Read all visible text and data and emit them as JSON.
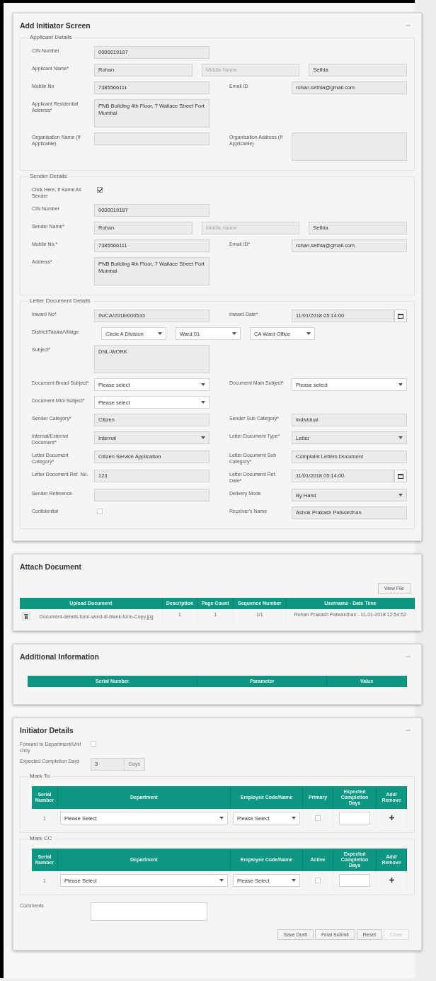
{
  "screen": {
    "title": "Add Initiator Screen",
    "collapsible": true,
    "fieldsets": [
      {
        "legend": "Applicant Details",
        "rows": [
          {
            "kind": "pair",
            "label": "CIN Number",
            "inputs": [
              {
                "kind": "text",
                "readonly": true,
                "value": "0000019187"
              }
            ]
          },
          {
            "kind": "multi",
            "label": "Applicant Name*",
            "inputs": [
              {
                "kind": "text",
                "readonly": true,
                "value": "Rohan"
              },
              {
                "kind": "text",
                "readonly": true,
                "placeholder": "Middle Name"
              },
              {
                "kind": "text",
                "readonly": true,
                "value": "Sethia"
              }
            ]
          },
          {
            "kind": "pair",
            "label": "Mobile No",
            "inputs": [
              {
                "kind": "text",
                "readonly": true,
                "value": "7385566111"
              }
            ],
            "label_2": "Email ID",
            "inputs_2": [
              {
                "kind": "text",
                "readonly": true,
                "value": "rohan.sethia@gmail.com"
              }
            ]
          },
          {
            "kind": "pair",
            "label": "Applicant Residential Address*",
            "inputs": [
              {
                "kind": "textarea",
                "readonly": true,
                "value": "PNB Building 4th Floor, 7 Wallace Street Fort Mumbai"
              }
            ]
          },
          {
            "kind": "pair",
            "label": "Organisation Name (If Applicable)",
            "inputs": [
              {
                "kind": "text",
                "readonly": true
              }
            ],
            "label_2": "Organisation Address (If Applicable)",
            "inputs_2": [
              {
                "kind": "textarea",
                "readonly": true
              }
            ]
          }
        ]
      },
      {
        "legend": "Sender Details",
        "rows": [
          {
            "kind": "pair",
            "label": "Click Here, If Same As Sender",
            "inputs": [
              {
                "kind": "checkbox",
                "checked": true
              }
            ]
          },
          {
            "kind": "pair",
            "label": "CIN Number",
            "inputs": [
              {
                "kind": "text",
                "readonly": true,
                "value": "0000019187"
              }
            ]
          },
          {
            "kind": "multi",
            "label": "Sender Name*",
            "inputs": [
              {
                "kind": "text",
                "readonly": true,
                "value": "Rohan"
              },
              {
                "kind": "text",
                "readonly": true,
                "placeholder": "Middle Name"
              },
              {
                "kind": "text",
                "readonly": true,
                "value": "Sethia"
              }
            ]
          },
          {
            "kind": "pair",
            "label": "Mobile No.*",
            "inputs": [
              {
                "kind": "text",
                "readonly": true,
                "value": "7385566111"
              }
            ],
            "label_2": "Email ID*",
            "inputs_2": [
              {
                "kind": "text",
                "readonly": true,
                "value": "rohan.sethia@gmail.com"
              }
            ]
          },
          {
            "kind": "pair",
            "label": "Address*",
            "inputs": [
              {
                "kind": "textarea",
                "readonly": true,
                "value": "PNB Building 4th Floor, 7 Wallace Street Fort Mumbai"
              }
            ]
          }
        ]
      },
      {
        "legend": "Letter Document Details",
        "rows": [
          {
            "kind": "pair",
            "label": "Inward No*",
            "inputs": [
              {
                "kind": "text",
                "readonly": true,
                "value": "IN/CA/2018/000533"
              }
            ],
            "label_2": "Inward Date*",
            "inputs_2": [
              {
                "kind": "date",
                "readonly": true,
                "value": "11/01/2018 05:14:00"
              }
            ]
          },
          {
            "kind": "multi",
            "label": "District/Taluka/Village",
            "inputs": [
              {
                "kind": "select",
                "readonly": false,
                "value": "Circle A Division"
              },
              {
                "kind": "select",
                "readonly": false,
                "value": "Ward 01"
              },
              {
                "kind": "select",
                "readonly": false,
                "value": "CA Ward Office"
              }
            ]
          },
          {
            "kind": "pair",
            "label": "Subject*",
            "inputs": [
              {
                "kind": "textarea",
                "readonly": true,
                "value": "DNL-WORK"
              }
            ]
          },
          {
            "kind": "pair",
            "label": "Document Broad Subject*",
            "inputs": [
              {
                "kind": "select",
                "readonly": false,
                "value": "Please select"
              }
            ],
            "label_2": "Document Main Subject*",
            "inputs_2": [
              {
                "kind": "select",
                "readonly": false,
                "value": "Please select"
              }
            ]
          },
          {
            "kind": "pair",
            "label": "Document Mini Subject*",
            "inputs": [
              {
                "kind": "select",
                "readonly": false,
                "value": "Please select"
              }
            ]
          },
          {
            "kind": "pair",
            "label": "Sender Category*",
            "inputs": [
              {
                "kind": "text",
                "readonly": true,
                "value": "Citizen"
              }
            ],
            "label_2": "Sender Sub Category*",
            "inputs_2": [
              {
                "kind": "text",
                "readonly": true,
                "value": "Individual"
              }
            ]
          },
          {
            "kind": "pair",
            "label": "Internal/External Document*",
            "inputs": [
              {
                "kind": "select",
                "readonly": true,
                "value": "Internal"
              }
            ],
            "label_2": "Letter Document Type*",
            "inputs_2": [
              {
                "kind": "select",
                "readonly": true,
                "value": "Letter"
              }
            ]
          },
          {
            "kind": "pair",
            "label": "Letter Document Category*",
            "inputs": [
              {
                "kind": "text",
                "readonly": true,
                "value": "Citizen Service Application"
              }
            ],
            "label_2": "Letter Document Sub Category*",
            "inputs_2": [
              {
                "kind": "text",
                "readonly": true,
                "value": "Complaint Letters Document"
              }
            ]
          },
          {
            "kind": "pair",
            "label": "Letter Document Ref. No.",
            "inputs": [
              {
                "kind": "text",
                "readonly": true,
                "value": "123"
              }
            ],
            "label_2": "Letter Document Ref. Date*",
            "inputs_2": [
              {
                "kind": "date",
                "readonly": true,
                "value": "11/01/2018 05:14:00"
              }
            ]
          },
          {
            "kind": "pair",
            "label": "Sender Reference",
            "inputs": [
              {
                "kind": "text",
                "readonly": true
              }
            ],
            "label_2": "Delivery Mode",
            "inputs_2": [
              {
                "kind": "select",
                "readonly": true,
                "value": "By Hand"
              }
            ]
          },
          {
            "kind": "pair",
            "label": "Confidential",
            "inputs": [
              {
                "kind": "checkbox",
                "checked": false
              }
            ],
            "label_2": "Receiver's Name",
            "inputs_2": [
              {
                "kind": "text",
                "readonly": true,
                "value": "Ashok Prakash Patwardhan"
              }
            ]
          }
        ]
      }
    ]
  },
  "attach": {
    "title": "Attach Document",
    "view_button": "View File",
    "columns": [
      "Upload Document",
      "Description",
      "Page Count",
      "Sequence Number",
      "Username - Date Time"
    ],
    "rows": [
      {
        "cells": [
          "Document-details-form-word-dl-blank-form-Copy.jpg",
          "1",
          "1",
          "1/1",
          "Rohan Prakash Patwardhan - 11-01-2018 12:54:52"
        ]
      }
    ]
  },
  "additional": {
    "title": "Additional Information",
    "collapsible": true,
    "columns": [
      "Serial Number",
      "Parameter",
      "Value"
    ]
  },
  "initiator": {
    "title": "Initiator Details",
    "collapsible": true,
    "forward": {
      "label": "Forward to Department/Unit Only",
      "checked": false
    },
    "expected": {
      "label": "Expected Completion Days",
      "value": "3",
      "addon": "Days"
    },
    "mark_tables": [
      {
        "legend": "Mark To",
        "columns": [
          "Serial Number",
          "Department",
          "Employee Code/Name",
          "Primary",
          "Expected Completion Days",
          "Add/ Remove"
        ],
        "rows": [
          {
            "serial": "1",
            "department": "Please Select",
            "employee": "Please Select",
            "checked": false
          }
        ]
      },
      {
        "legend": "Mark CC",
        "columns": [
          "Serial Number",
          "Department",
          "Employee Code/Name",
          "Active",
          "Expected Completion Days",
          "Add/ Remove"
        ],
        "rows": [
          {
            "serial": "1",
            "department": "Please Select",
            "employee": "Please Select",
            "checked": false
          }
        ]
      }
    ],
    "comments": {
      "label": "Comments"
    },
    "buttons": [
      {
        "label": "Save Draft",
        "disabled": false
      },
      {
        "label": "Final Submit",
        "disabled": false
      },
      {
        "label": "Reset",
        "disabled": false
      },
      {
        "label": "Close",
        "disabled": true
      }
    ]
  }
}
